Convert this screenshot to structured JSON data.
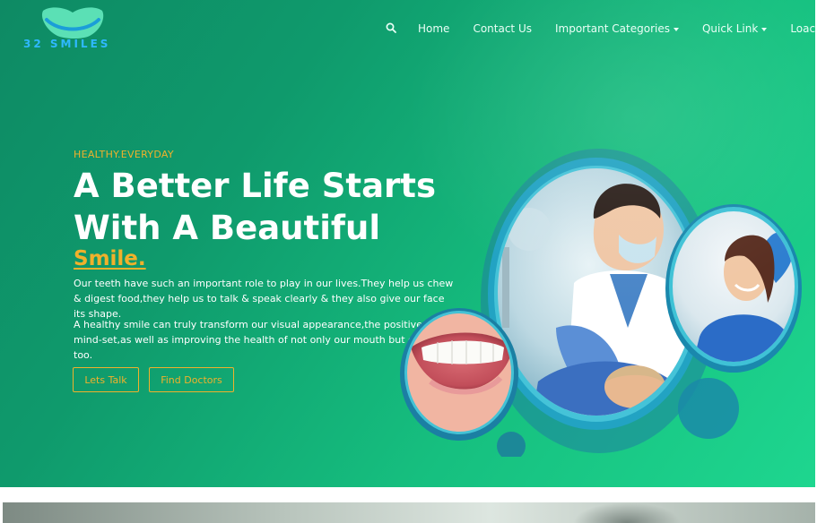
{
  "brand": {
    "name": "32 SMILES"
  },
  "nav": {
    "search_icon": "search-icon",
    "items": [
      "Home",
      "Contact Us",
      "Important Categories",
      "Quick Link",
      "Loaction"
    ]
  },
  "hero": {
    "eyebrow": "HEALTHY.EVERYDAY",
    "headline_line1": "A Better Life Starts",
    "headline_line2": "With A Beautiful",
    "headline_accent": "Smile.",
    "paragraph1": "Our teeth have such an important role to play in our lives.They help us chew & digest food,they help us to talk & speak clearly & they also give our face its shape.",
    "paragraph2": "A healthy smile can truly transform our visual appearance,the positive of our mind-set,as well as improving the health of not only our mouth but our body too.",
    "btn_talk": "Lets Talk",
    "btn_doctors": "Find Doctors"
  },
  "colors": {
    "accent": "#f0b12b",
    "hero_start": "#0e8a64",
    "hero_end": "#1ed68f",
    "logo_text": "#2fb8ff"
  }
}
